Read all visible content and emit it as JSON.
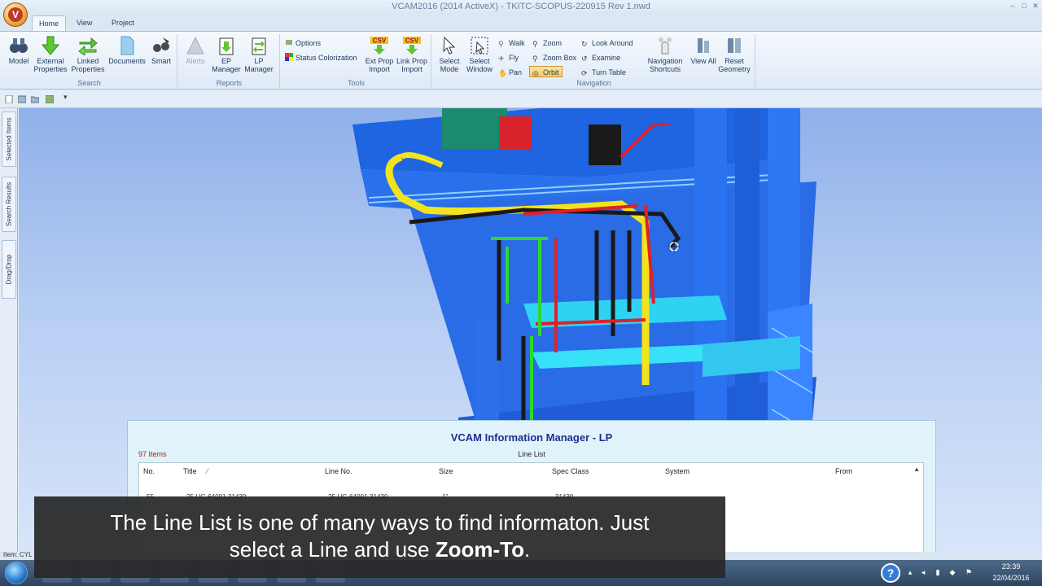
{
  "window": {
    "title": "VCAM2016 (2014 ActiveX) - TKITC-SCOPUS-220915 Rev 1.nwd",
    "logo_letter": "V"
  },
  "tabs": [
    {
      "label": "Home"
    },
    {
      "label": "View"
    },
    {
      "label": "Project"
    }
  ],
  "ribbon": {
    "search": {
      "label": "Search",
      "buttons": [
        "Model",
        "External Properties",
        "Linked Properties",
        "Documents",
        "Smart"
      ]
    },
    "reports": {
      "label": "Reports",
      "buttons": [
        "Alerts",
        "EP Manager",
        "LP Manager"
      ]
    },
    "tools": {
      "label": "Tools",
      "options": "Options",
      "status_colorization": "Status Colorization",
      "ext_prop_import": "Ext Prop Import",
      "link_prop_import": "Link Prop Import",
      "csv_badge": "CSV"
    },
    "navigation": {
      "label": "Navigation",
      "select_mode": "Select Mode",
      "select_window": "Select Window",
      "walk": "Walk",
      "fly": "Fly",
      "pan": "Pan",
      "zoom": "Zoom",
      "zoom_box": "Zoom Box",
      "orbit": "Orbit",
      "look_around": "Look Around",
      "examine": "Examine",
      "turn_table": "Turn Table",
      "navigation_shortcuts": "Navigation Shortcuts",
      "view_all": "View All",
      "reset_geometry": "Reset Geometry"
    }
  },
  "sidebar": {
    "tabs": [
      "Selected Items",
      "Search Results",
      "Drag/Drop"
    ]
  },
  "lp_panel": {
    "title": "VCAM Information Manager - LP",
    "count": "97 Items",
    "subtitle": "Line List",
    "columns": [
      "No.",
      "Title",
      "Line No.",
      "Size",
      "Spec Class",
      "System",
      "From"
    ],
    "sort_indicator": "⁄",
    "row": [
      "55",
      "25-UG-64001-31430",
      "25-UG-64001-31430",
      "1\"",
      "31430"
    ]
  },
  "statusbar": {
    "text": "Item: CYL"
  },
  "caption": {
    "line1": "The Line List is one of many ways to find informaton. Just",
    "line2_prefix": "select a Line and use ",
    "line2_bold": "Zoom-To",
    "line2_suffix": "."
  },
  "taskbar": {
    "time": "23:39",
    "date": "22/04/2016"
  },
  "colors": {
    "structure_blue": "#1f64e0",
    "pipe_yellow": "#f2e31c",
    "pipe_red": "#e0202a",
    "pipe_green": "#2ed82e",
    "cyan_deck": "#2fd3f2"
  }
}
